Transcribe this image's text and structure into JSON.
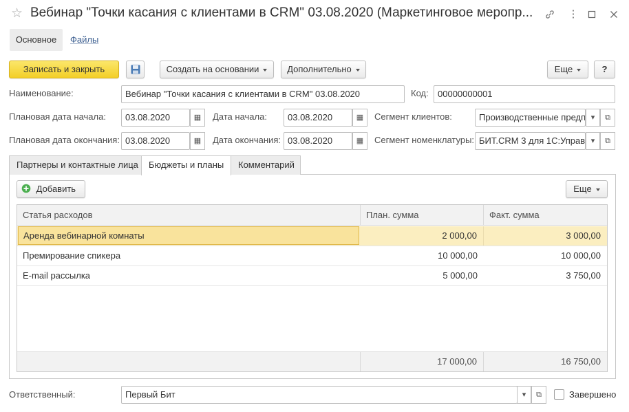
{
  "window": {
    "title": "Вебинар \"Точки касания с клиентами в CRM\" 03.08.2020 (Маркетинговое меропр...",
    "star_icon": "star-icon",
    "link_icon": "link-icon",
    "more_icon": "more-vertical-icon",
    "minimize_icon": "minimize-icon",
    "close_icon": "close-icon"
  },
  "nav": {
    "main": "Основное",
    "files": "Файлы"
  },
  "toolbar": {
    "save_close": "Записать и закрыть",
    "save_icon": "floppy-disk-icon",
    "create_based": "Создать на основании",
    "additional": "Дополнительно",
    "more": "Еще",
    "help": "?"
  },
  "form": {
    "name_label": "Наименование:",
    "name_value": "Вебинар \"Точки касания с клиентами в CRM\" 03.08.2020",
    "code_label": "Код:",
    "code_value": "00000000001",
    "plan_start_label": "Плановая дата начала:",
    "plan_start_value": "03.08.2020",
    "start_label": "Дата начала:",
    "start_value": "03.08.2020",
    "segment_clients_label": "Сегмент клиентов:",
    "segment_clients_value": "Производственные предп",
    "plan_end_label": "Плановая дата окончания:",
    "plan_end_value": "03.08.2020",
    "end_label": "Дата окончания:",
    "end_value": "03.08.2020",
    "segment_nom_label": "Сегмент номенклатуры:",
    "segment_nom_value": "БИТ.CRM 3 для 1С:Управ"
  },
  "tabs": [
    "Партнеры и контактные лица",
    "Бюджеты и планы",
    "Комментарий"
  ],
  "active_tab": "Бюджеты и планы",
  "table_toolbar": {
    "add": "Добавить",
    "more": "Еще"
  },
  "table": {
    "columns": [
      "Статья расходов",
      "План. сумма",
      "Факт. сумма"
    ],
    "rows": [
      {
        "item": "Аренда вебинарной комнаты",
        "plan": "2 000,00",
        "fact": "3 000,00"
      },
      {
        "item": "Премирование спикера",
        "plan": "10 000,00",
        "fact": "10 000,00"
      },
      {
        "item": "E-mail рассылка",
        "plan": "5 000,00",
        "fact": "3 750,00"
      }
    ],
    "totals": {
      "plan": "17 000,00",
      "fact": "16 750,00"
    }
  },
  "footer": {
    "responsible_label": "Ответственный:",
    "responsible_value": "Первый Бит",
    "completed_label": "Завершено",
    "completed": false
  },
  "colors": {
    "accent_yellow": "#f5d434",
    "selected_row": "#fbeec0",
    "link": "#3a5d8f"
  }
}
